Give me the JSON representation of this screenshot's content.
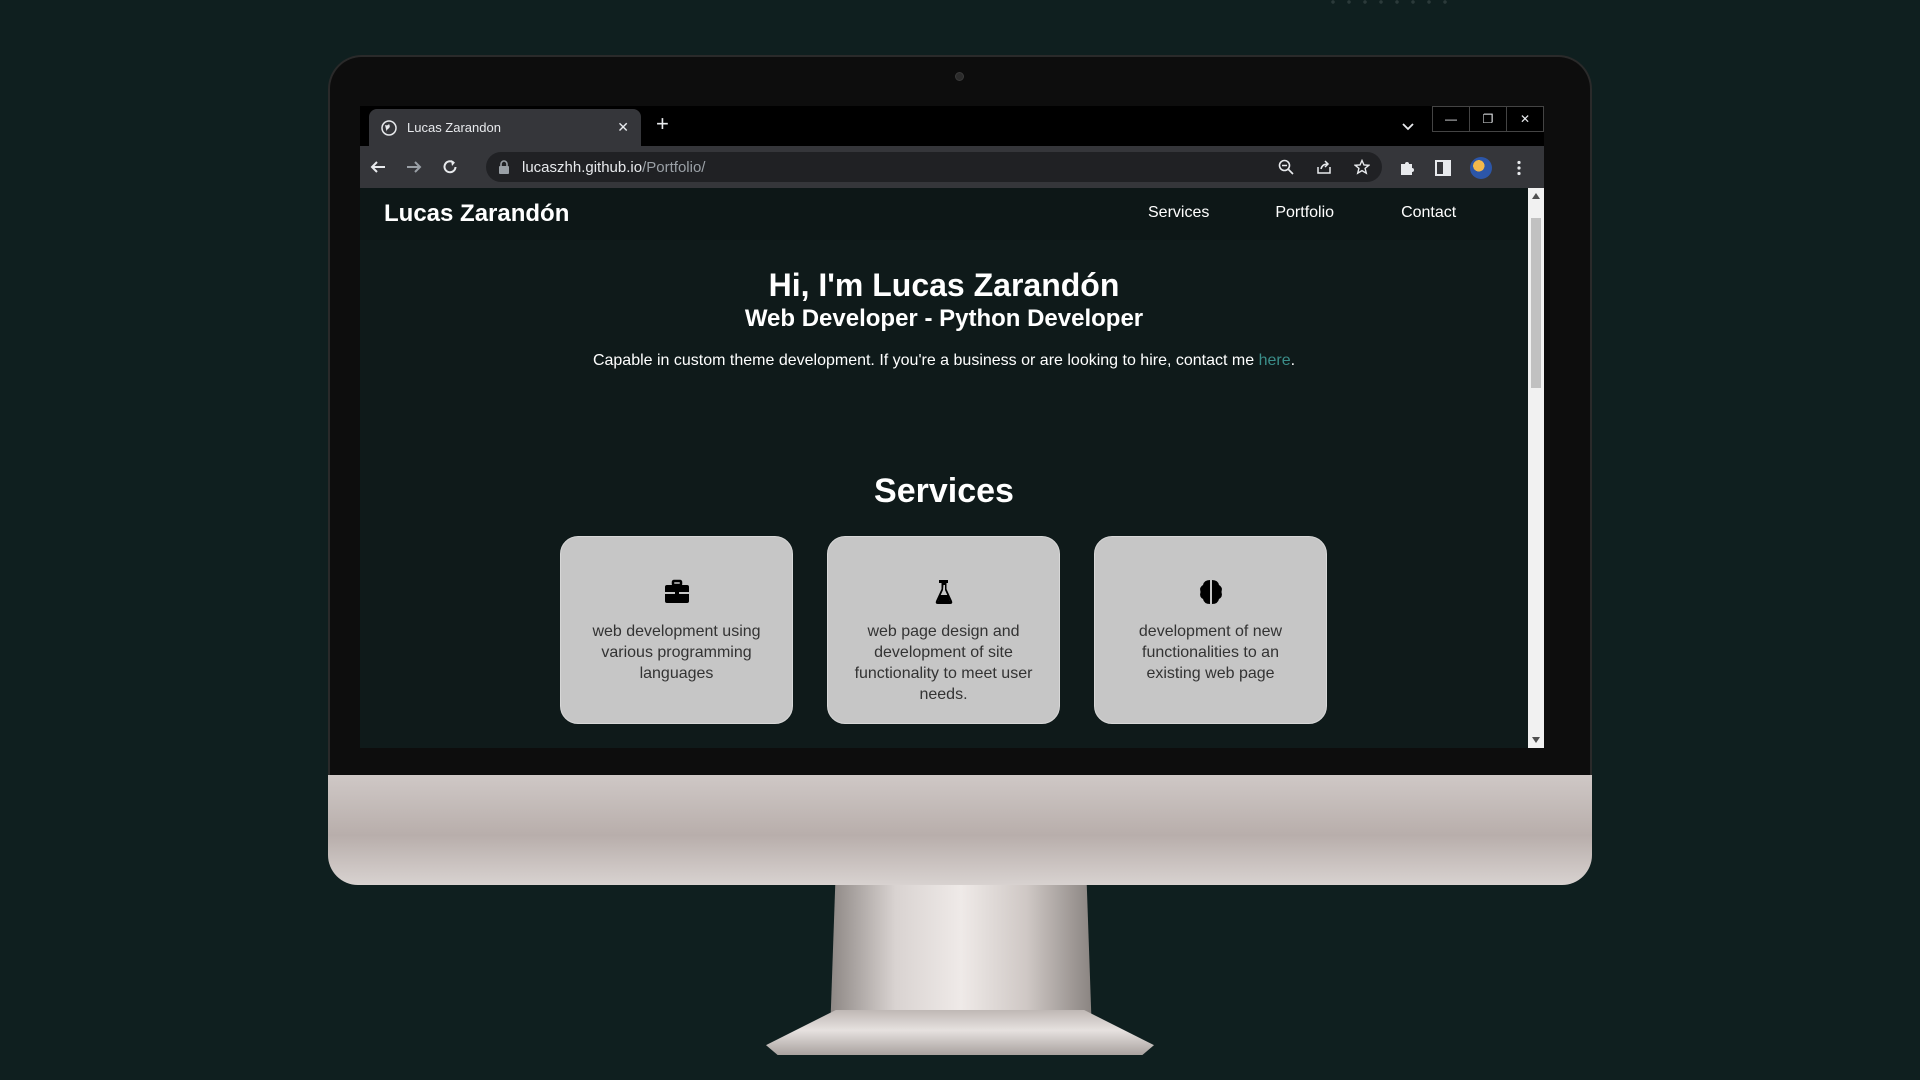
{
  "browser": {
    "tab_title": "Lucas Zarandon",
    "url_host": "lucaszhh.github.io",
    "url_path": "/Portfolio/"
  },
  "site": {
    "brand": "Lucas Zarandón",
    "nav": [
      "Services",
      "Portfolio",
      "Contact"
    ],
    "hero": {
      "title": "Hi, I'm Lucas Zarandón",
      "subtitle": "Web Developer - Python Developer",
      "text_before_link": "Capable in custom theme development. If you're a business or are looking to hire, contact me ",
      "link_text": "here",
      "text_after_link": "."
    },
    "services_title": "Services",
    "services": [
      {
        "icon": "briefcase-icon",
        "text": "web development using various programming languages"
      },
      {
        "icon": "flask-icon",
        "text": "web page design and development of site functionality to meet user needs."
      },
      {
        "icon": "brain-icon",
        "text": "development of new functionalities to an existing web page"
      }
    ]
  },
  "colors": {
    "background": "#0f1f1f",
    "page_background": "#0f1a1a",
    "link": "#3b8e8a",
    "card": "#c6c6c6"
  }
}
